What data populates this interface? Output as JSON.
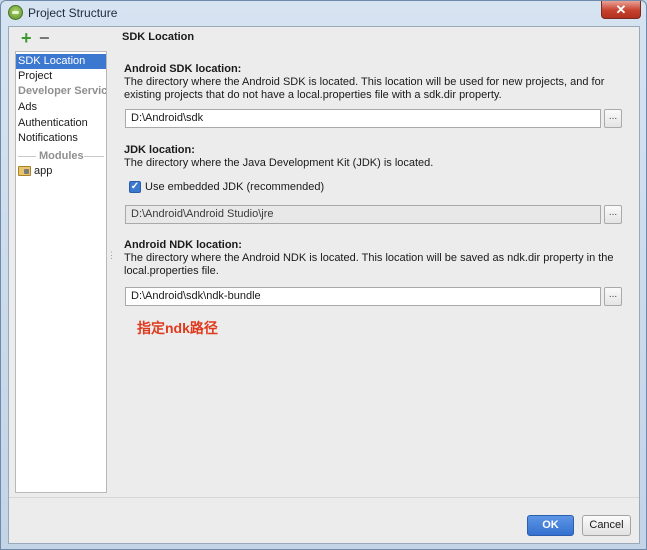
{
  "window": {
    "title": "Project Structure",
    "close_glyph": "✕"
  },
  "toolbar": {
    "add_glyph": "+",
    "remove_glyph": "−"
  },
  "sidebar": {
    "items": [
      {
        "label": "SDK Location",
        "selected": true
      },
      {
        "label": "Project"
      },
      {
        "label": "Developer Servic..."
      },
      {
        "label": "Ads"
      },
      {
        "label": "Authentication"
      },
      {
        "label": "Notifications"
      }
    ],
    "modules_header": "Modules",
    "modules": [
      {
        "label": "app",
        "icon": "module-folder-icon"
      }
    ]
  },
  "content": {
    "title": "SDK Location",
    "sdk": {
      "label": "Android SDK location:",
      "description": "The directory where the Android SDK is located. This location will be used for new projects, and for existing projects that do not have a local.properties file with a sdk.dir property.",
      "value": "D:\\Android\\sdk",
      "browse": "..."
    },
    "jdk": {
      "label": "JDK location:",
      "description": "The directory where the Java Development Kit (JDK) is located.",
      "checkbox_label": "Use embedded JDK (recommended)",
      "checkbox_checked": true,
      "value": "D:\\Android\\Android Studio\\jre",
      "browse": "..."
    },
    "ndk": {
      "label": "Android NDK location:",
      "description": "The directory where the Android NDK is located. This location will be saved as ndk.dir property in the local.properties file.",
      "value": "D:\\Android\\sdk\\ndk-bundle",
      "browse": "..."
    },
    "annotation": "指定ndk路径"
  },
  "footer": {
    "ok_label": "OK",
    "cancel_label": "Cancel"
  },
  "colors": {
    "accent": "#3d78d0",
    "annotation": "#e03a1e"
  }
}
